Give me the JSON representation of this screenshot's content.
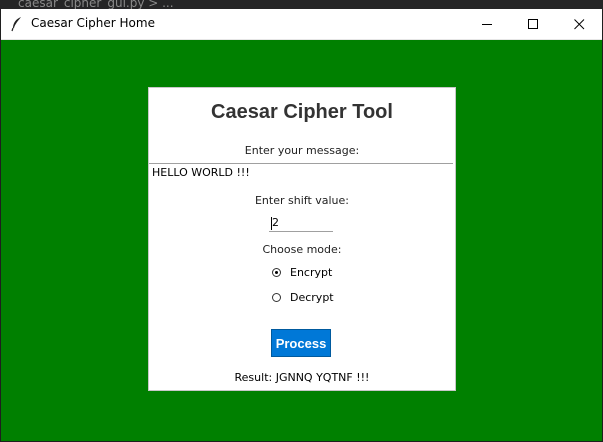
{
  "editor": {
    "tab_text": "caesar_cipher_gui.py > ..."
  },
  "window": {
    "title": "Caesar Cipher Home",
    "icon": "feather-icon",
    "controls": {
      "minimize": "minimize-icon",
      "maximize": "maximize-icon",
      "close": "close-icon"
    },
    "background_color": "#008000"
  },
  "panel": {
    "heading": "Caesar Cipher Tool",
    "message_label": "Enter your message:",
    "message_value": "HELLO WORLD !!!",
    "shift_label": "Enter shift value:",
    "shift_value": "2",
    "mode_label": "Choose mode:",
    "modes": [
      {
        "label": "Encrypt",
        "selected": true
      },
      {
        "label": "Decrypt",
        "selected": false
      }
    ],
    "process_label": "Process",
    "process_color": "#0078d7",
    "result_text": "Result: JGNNQ YQTNF !!!"
  }
}
